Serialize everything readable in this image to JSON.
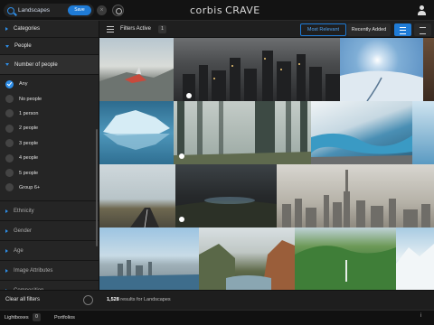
{
  "header": {
    "search_value": "Landscapes",
    "save_label": "Save",
    "brand_name": "corbis",
    "brand_product": "CRAVE"
  },
  "sidebar": {
    "sections": [
      {
        "label": "Categories"
      },
      {
        "label": "People"
      },
      {
        "label": "Number of people"
      }
    ],
    "people_options": [
      {
        "label": "Any",
        "selected": true
      },
      {
        "label": "No people",
        "selected": false
      },
      {
        "label": "1 person",
        "selected": false
      },
      {
        "label": "2 people",
        "selected": false
      },
      {
        "label": "3 people",
        "selected": false
      },
      {
        "label": "4 people",
        "selected": false
      },
      {
        "label": "5 people",
        "selected": false
      },
      {
        "label": "Group 6+",
        "selected": false
      }
    ],
    "more_sections": [
      {
        "label": "Ethnicity"
      },
      {
        "label": "Gender"
      },
      {
        "label": "Age"
      },
      {
        "label": "Image Attributes"
      },
      {
        "label": "Composition"
      }
    ],
    "clear_label": "Clear all filters"
  },
  "filterbar": {
    "label": "Filters Active",
    "count": "1",
    "sort_relevant": "Most Relevant",
    "sort_recent": "Recently Added"
  },
  "results": {
    "count": "1,528",
    "suffix": "results for Landscapes"
  },
  "footer": {
    "lightboxes": "Lightboxes",
    "lightbox_count": "0",
    "portfolios": "Portfolios",
    "info": "i"
  },
  "colors": {
    "accent": "#1f7bd6",
    "sidebar": "#252525",
    "background": "#1b1b1b"
  }
}
